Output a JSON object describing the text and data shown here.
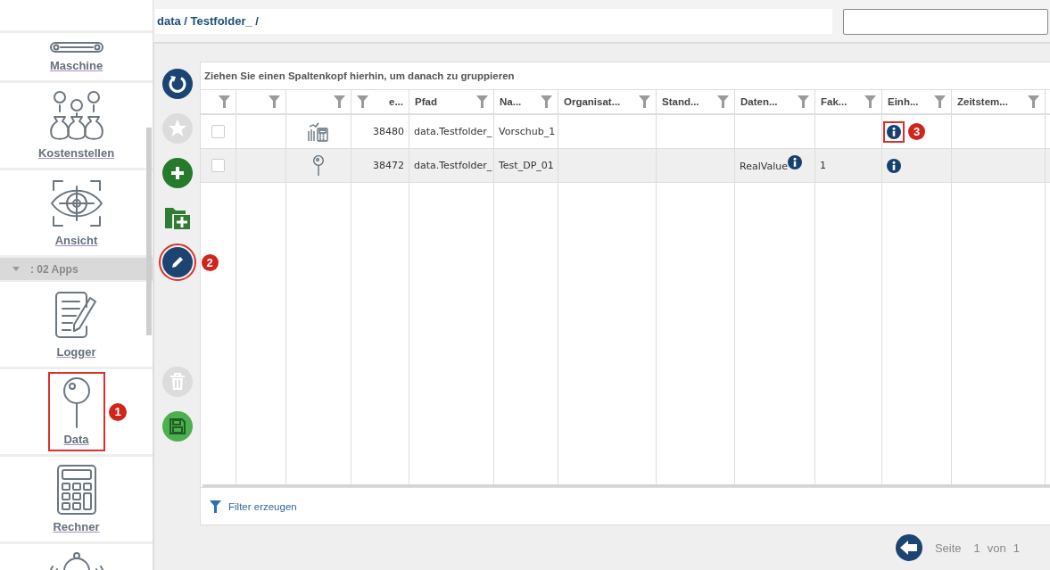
{
  "sidebar": {
    "items": [
      {
        "kind": "machine",
        "label": "Maschine"
      },
      {
        "kind": "money-bags",
        "label": "Kostenstellen"
      },
      {
        "kind": "eye",
        "label": "Ansicht"
      },
      {
        "kind": "group",
        "label": ": 02 Apps",
        "expanded": true
      },
      {
        "kind": "logger",
        "label": "Logger"
      },
      {
        "kind": "pin",
        "label": "Data",
        "callout": "1"
      },
      {
        "kind": "calculator",
        "label": "Rechner"
      },
      {
        "kind": "alarm"
      }
    ]
  },
  "breadcrumb": "data / Testfolder_ /",
  "toolbar": {
    "groups": [
      [
        {
          "kind": "refresh",
          "disabled": false
        },
        {
          "kind": "favorite",
          "disabled": true
        },
        {
          "kind": "add",
          "disabled": false
        },
        {
          "kind": "add-folder",
          "disabled": false
        },
        {
          "kind": "edit",
          "disabled": false,
          "callout": "2"
        }
      ],
      [
        {
          "kind": "delete",
          "disabled": true
        },
        {
          "kind": "save",
          "disabled": false
        }
      ]
    ]
  },
  "grid": {
    "group_hint": "Ziehen Sie einen Spaltenkopf hierhin, um danach zu gruppieren",
    "columns": [
      {
        "kind": "checkbox"
      },
      {
        "kind": "blank"
      },
      {
        "kind": "icon"
      },
      {
        "kind": "number",
        "label": "e..."
      },
      {
        "kind": "text",
        "label": "Pfad"
      },
      {
        "kind": "text",
        "label": "Na..."
      },
      {
        "kind": "text",
        "label": "Organisat..."
      },
      {
        "kind": "text",
        "label": "Stand..."
      },
      {
        "kind": "text",
        "label": "Daten..."
      },
      {
        "kind": "text",
        "label": "Fak..."
      },
      {
        "kind": "text",
        "label": "Einh..."
      },
      {
        "kind": "text",
        "label": "Zeitstem..."
      }
    ],
    "rows": [
      {
        "cells": [
          {
            "checked": false
          },
          "",
          {
            "kind": "chart-calculator"
          },
          "38480",
          "data.Testfolder_",
          "Vorschub_1",
          "",
          "",
          "",
          "",
          {
            "info": true,
            "callout": "3"
          },
          ""
        ]
      },
      {
        "cells": [
          {
            "checked": false
          },
          "",
          {
            "kind": "pin"
          },
          "38472",
          "data.Testfolder_",
          "Test_DP_01",
          "",
          "",
          {
            "text": "RealValue",
            "info": true
          },
          "1",
          {
            "info": true
          },
          ""
        ]
      }
    ],
    "filter_link": "Filter erzeugen"
  },
  "pager": {
    "label": "Seite",
    "page": "1",
    "of": "von",
    "total": "1"
  }
}
